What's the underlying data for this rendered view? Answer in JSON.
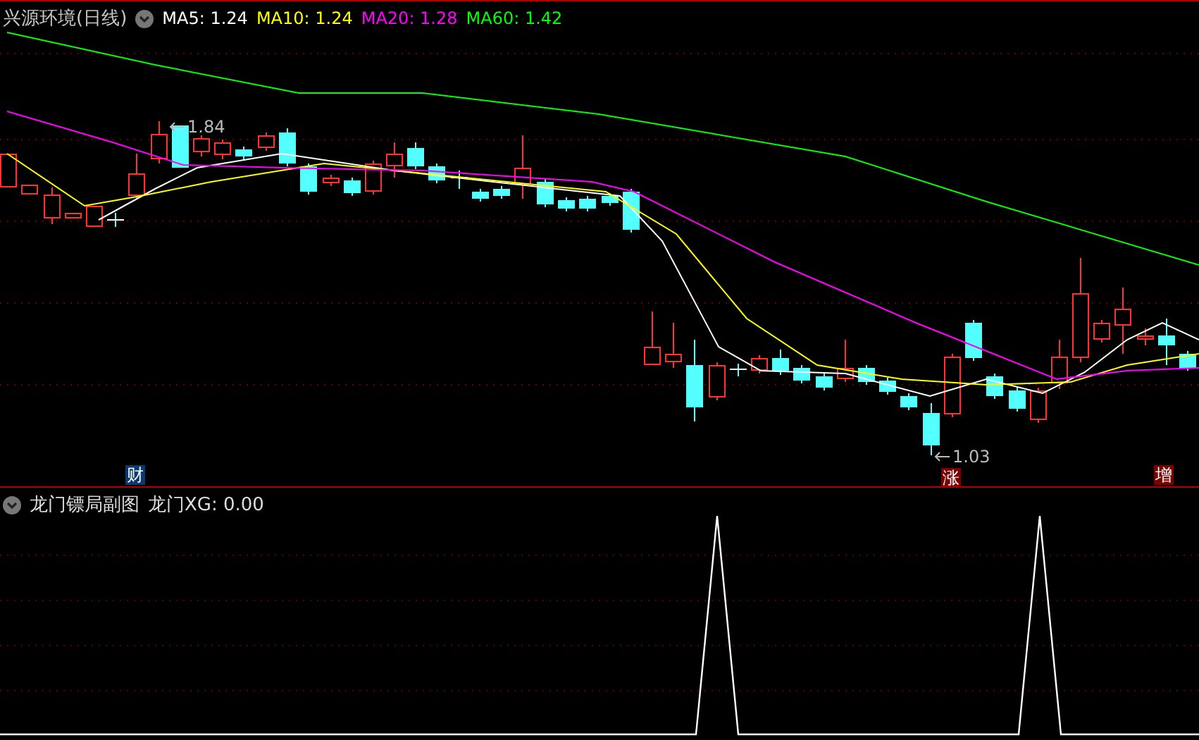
{
  "main_chart": {
    "title": "兴源环境(日线)",
    "indicators": [
      {
        "label": "MA5: 1.24",
        "color": "#ffffff"
      },
      {
        "label": "MA10: 1.24",
        "color": "#ffff00"
      },
      {
        "label": "MA20: 1.28",
        "color": "#ff00ff"
      },
      {
        "label": "MA60: 1.42",
        "color": "#00ff00"
      }
    ],
    "annotations": [
      {
        "text": "1.84"
      },
      {
        "text": "1.03"
      }
    ],
    "markers": [
      {
        "text": "财",
        "color": "#0a3a6e"
      },
      {
        "text": "涨",
        "color": "#7a0000"
      },
      {
        "text": "增",
        "color": "#7a0000"
      }
    ]
  },
  "sub_chart": {
    "title": "龙门镖局副图",
    "indicator": "龙门XG: 0.00"
  }
}
